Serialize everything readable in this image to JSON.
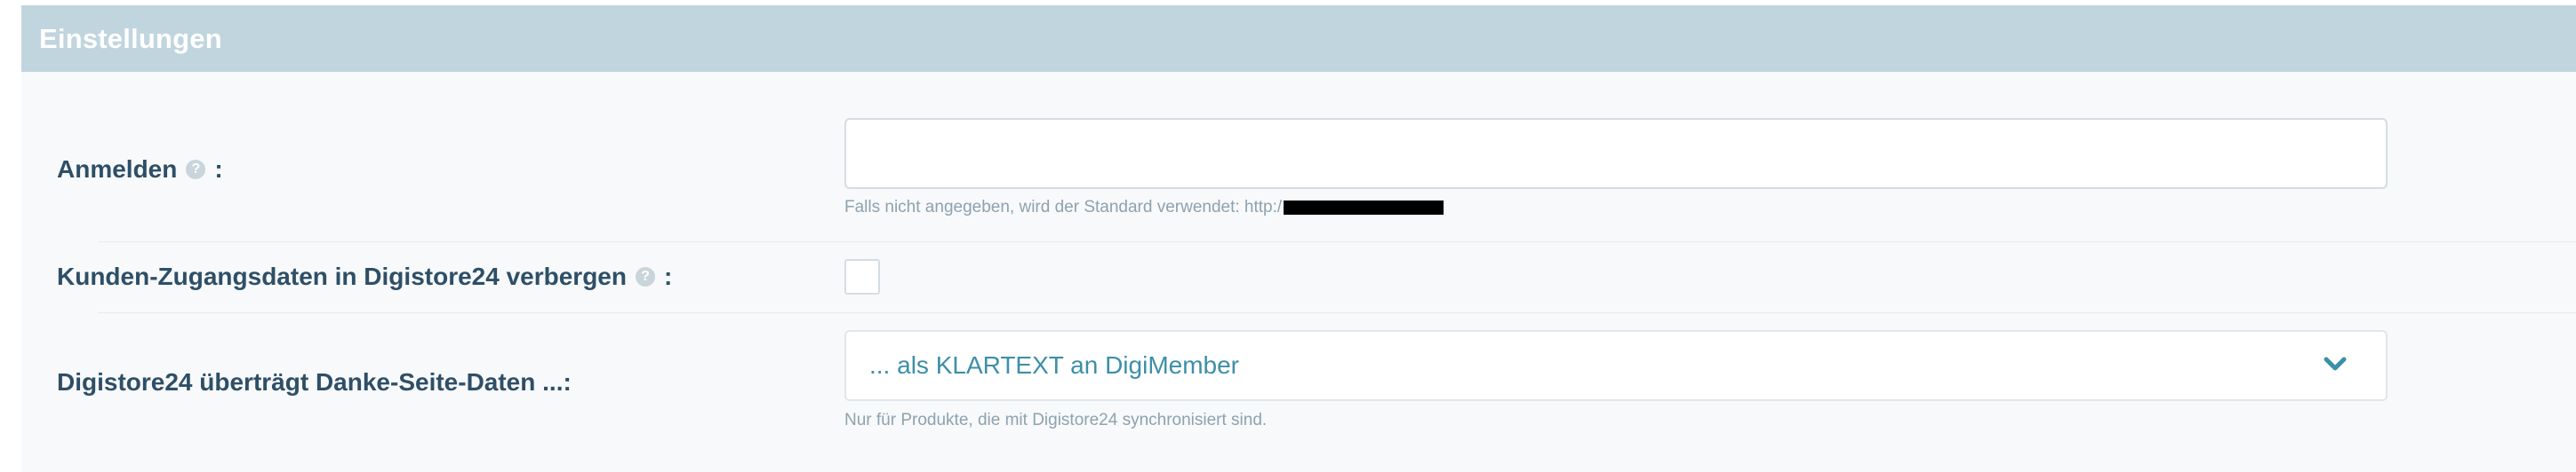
{
  "panel": {
    "title": "Einstellungen"
  },
  "fields": {
    "login": {
      "label": "Anmelden",
      "colon": ":",
      "value": "",
      "hint": "Falls nicht angegeben, wird der Standard verwendet: http:/"
    },
    "hide_credentials": {
      "label": "Kunden-Zugangsdaten in Digistore24 verbergen",
      "colon": ":",
      "checked": false
    },
    "thankyou_data": {
      "label": "Digistore24 überträgt Danke-Seite-Daten ...:",
      "selected": "... als KLARTEXT an DigiMember",
      "hint": "Nur für Produkte, die mit Digistore24 synchronisiert sind."
    }
  },
  "icons": {
    "help": "help-icon",
    "chevron": "chevron-down-icon",
    "help_glyph": "?"
  },
  "colors": {
    "header_bg": "#c1d5df",
    "label": "#2e4f66",
    "accent": "#3d8fa8",
    "hint": "#8ea2ae"
  }
}
